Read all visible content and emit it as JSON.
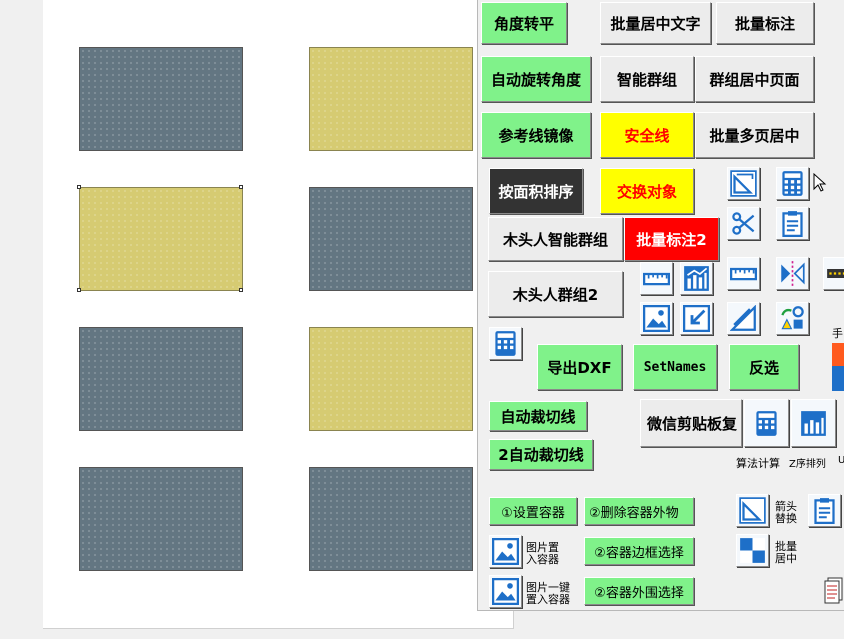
{
  "colors": {
    "panel_bg": "#f0f0f0",
    "green": "#80f28a",
    "yellow": "#ffff00",
    "red": "#ff0000",
    "dark": "#333333",
    "rect_gray": "#637682",
    "rect_yellow": "#d6cb72",
    "icon_blue": "#1e6fc8"
  },
  "buttons": {
    "rotate_flat": "角度转平",
    "batch_center_text": "批量居中文字",
    "batch_label": "批量标注",
    "auto_rotate": "自动旋转角度",
    "smart_group": "智能群组",
    "group_center_page": "群组居中页面",
    "ref_line_mirror": "参考线镜像",
    "safety_line": "安全线",
    "batch_multipage_center": "批量多页居中",
    "sort_by_area": "按面积排序",
    "swap_objects": "交换对象",
    "wood_smart_group": "木头人智能群组",
    "batch_label_2": "批量标注2",
    "wood_group_2": "木头人群组2",
    "export_dxf": "导出DXF",
    "set_names": "SetNames",
    "invert_select": "反选",
    "auto_cut_line": "自动裁切线",
    "auto_cut_line_2": "2自动裁切线",
    "wechat_clipboard": "微信剪贴板复",
    "set_container": "①设置容器",
    "delete_outside": "②删除容器外物",
    "container_border_select": "②容器边框选择",
    "container_outer_select": "②容器外围选择"
  },
  "labels": {
    "algo_calc": "算法计算",
    "z_order": "Z序排列",
    "u_cut": "U",
    "hand": "手",
    "arrow_swap_1": "箭头",
    "arrow_swap_2": "替换",
    "img_into_container_1": "图片置",
    "img_into_container_2": "入容器",
    "img_one_key_1": "图片一键",
    "img_one_key_2": "置入容器",
    "batch_center_1": "批量",
    "batch_center_2": "居中"
  },
  "icons": [
    "ruler-triangle-icon",
    "calculator-icon",
    "scissors-icon",
    "clipboard-icon",
    "ruler-icon",
    "chart-bars-icon",
    "mirror-icon",
    "tape-icon",
    "image-icon",
    "shrink-arrow-icon",
    "pencil-ruler-icon",
    "shapes-icon",
    "checker-icon",
    "document-icon",
    "mouse-cursor-icon"
  ]
}
